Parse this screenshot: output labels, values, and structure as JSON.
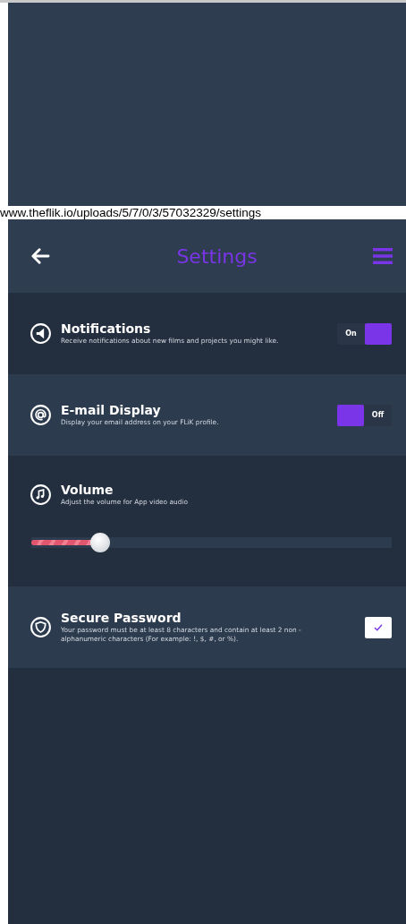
{
  "caption": "www.theflik.io/uploads/5/7/0/3/57032329/settings",
  "header": {
    "title": "Settings"
  },
  "settings": [
    {
      "kind": "toggle",
      "title": "Notifications",
      "description": "Receive notifications about new films and projects you might like.",
      "on": true,
      "label": "On"
    },
    {
      "kind": "toggle",
      "title": "E-mail Display",
      "description": "Display your email address on your FLiK profile.",
      "on": false,
      "label": "Off"
    },
    {
      "kind": "slider",
      "title": "Volume",
      "description": "Adjust the volume for App video audio",
      "level": 0.19
    },
    {
      "kind": "checkbox",
      "title": "Secure Password",
      "description": "Your password must be at least 8 characters and contain at least 2 non - alphanumeric characters (For example: !, $, #, or %).",
      "checked": true
    }
  ]
}
